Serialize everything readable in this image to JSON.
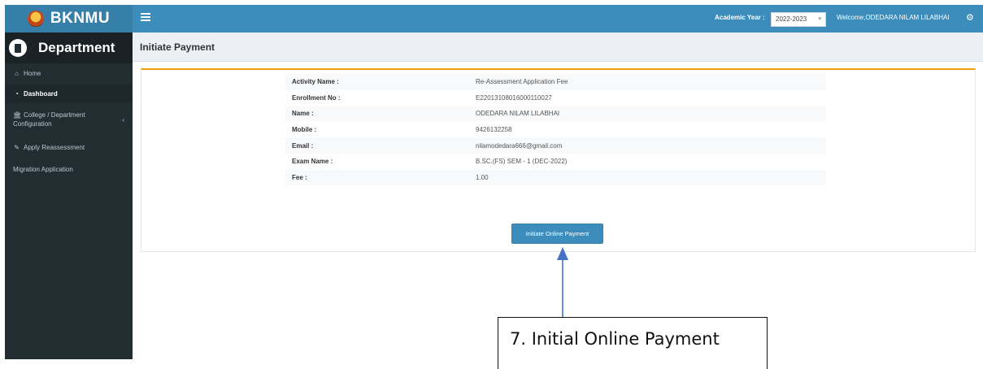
{
  "brand": {
    "name": "BKNMU"
  },
  "topbar": {
    "academic_year_label": "Academic Year :",
    "academic_year_value": "2022-2023",
    "welcome_text": "Welcome,ODEDARA NILAM LILABHAI"
  },
  "sidebar": {
    "title": "Department",
    "items": [
      {
        "label": "Home",
        "icon": "home-icon"
      },
      {
        "label": "Dashboard",
        "icon": "dashboard-icon",
        "active": true
      },
      {
        "label_line1": "College / Department",
        "label_line2": "Configuration",
        "icon": "bank-icon"
      },
      {
        "label": "Apply Reassessment",
        "icon": "pencil-icon"
      },
      {
        "label": "Migration Application"
      }
    ]
  },
  "page": {
    "title": "Initiate Payment",
    "fields": [
      {
        "label": "Activity Name :",
        "value": "Re-Assessment Application Fee"
      },
      {
        "label": "Enrollment No :",
        "value": "E22013108016000110027"
      },
      {
        "label": "Name :",
        "value": "ODEDARA NILAM LILABHAI"
      },
      {
        "label": "Mobile :",
        "value": "9426132258"
      },
      {
        "label": "Email :",
        "value": "nilamodedara666@gmail.com"
      },
      {
        "label": "Exam Name :",
        "value": "B.SC.(FS) SEM - 1 (DEC-2022)"
      },
      {
        "label": "Fee :",
        "value": "1.00"
      }
    ],
    "pay_button": "Initiate Online Payment"
  },
  "annotation": {
    "text": "7. Initial Online Payment"
  },
  "colors": {
    "header": "#3c8dbc",
    "brand": "#367fa9",
    "sidebar": "#222d32",
    "box_border_top": "#f39c12",
    "arrow": "#4472c4"
  }
}
